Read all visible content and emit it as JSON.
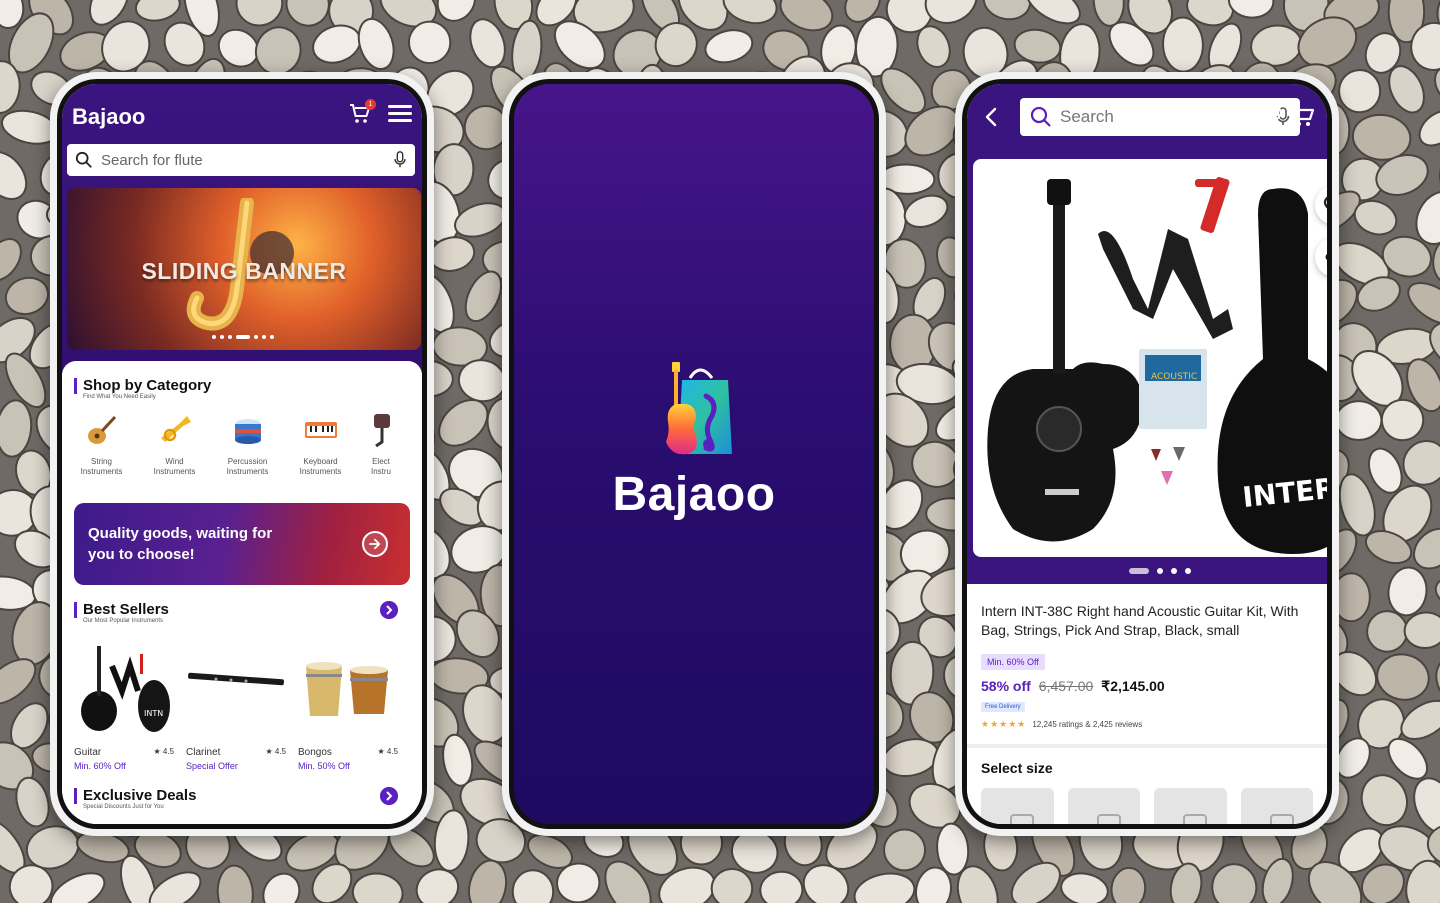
{
  "colors": {
    "brand_purple": "#3a1580",
    "accent": "#5a20c0",
    "sale_red": "#e53935"
  },
  "home": {
    "brand": "Bajaoo",
    "cart_count": "1",
    "search_placeholder": "Search for flute",
    "banner_text": "SLIDING BANNER",
    "shop_by_category": {
      "title": "Shop by Category",
      "subtitle": "Find What You Need Easily"
    },
    "categories": [
      {
        "label": "String Instruments",
        "icon": "guitar-icon"
      },
      {
        "label": "Wind Instruments",
        "icon": "trumpet-icon"
      },
      {
        "label": "Percussion Instruments",
        "icon": "drum-icon"
      },
      {
        "label": "Keyboard Instruments",
        "icon": "keyboard-icon"
      },
      {
        "label": "Elect Instru",
        "icon": "electric-icon"
      }
    ],
    "promo_text": "Quality goods, waiting for you to choose!",
    "best_sellers": {
      "title": "Best Sellers",
      "subtitle": "Our Most Popular Instruments"
    },
    "products": [
      {
        "name": "Guitar",
        "rating": "★ 4.5",
        "offer": "Min. 60% Off"
      },
      {
        "name": "Clarinet",
        "rating": "★ 4.5",
        "offer": "Special Offer"
      },
      {
        "name": "Bongos",
        "rating": "★ 4.5",
        "offer": "Min. 50% Off"
      }
    ],
    "exclusive_deals": {
      "title": "Exclusive Deals",
      "subtitle": "Special Discounts Just for You"
    }
  },
  "splash": {
    "brand": "Bajaoo"
  },
  "product": {
    "search_placeholder": "Search",
    "title": "Intern INT-38C Right hand Acoustic Guitar Kit, With Bag, Strings, Pick And Strap, Black, small",
    "chip": "Min. 60% Off",
    "discount": "58% off",
    "mrp": "6,457.00",
    "price": "₹2,145.00",
    "delivery": "Free Delivery",
    "stars": "★★★★★",
    "ratings_text": "12,245 ratings & 2,425 reviews",
    "select_size": "Select size"
  }
}
